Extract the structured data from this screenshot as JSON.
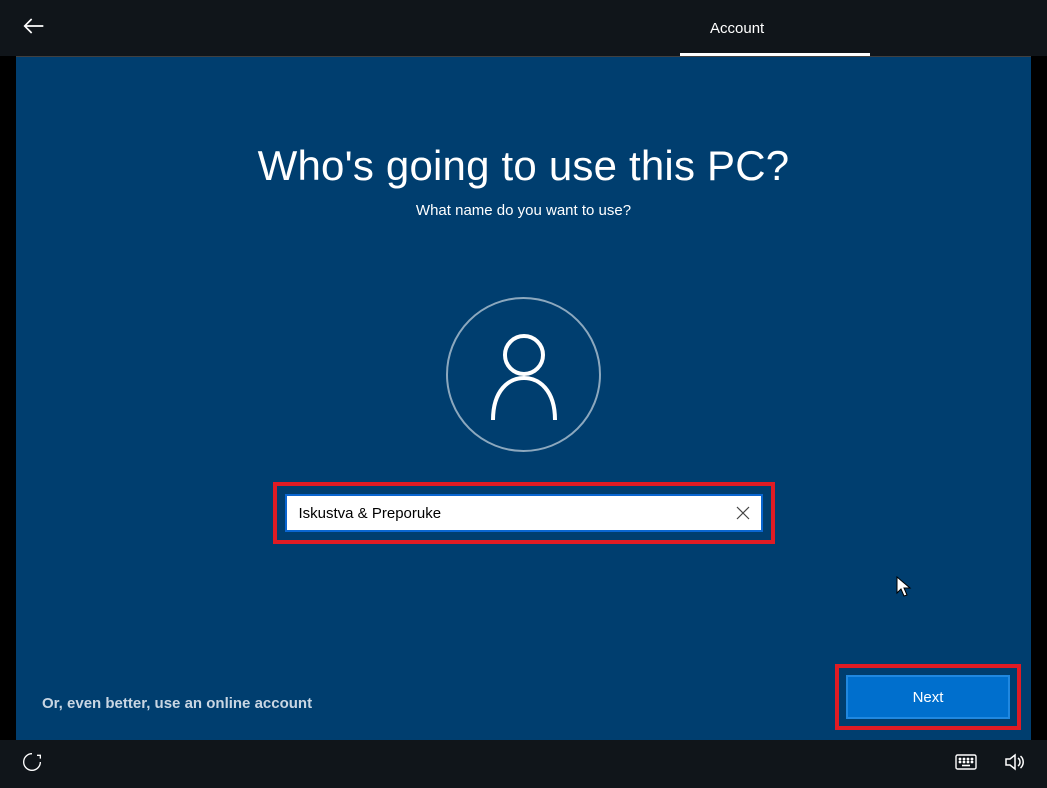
{
  "header": {
    "tab_label": "Account"
  },
  "main": {
    "title": "Who's going to use this PC?",
    "subtitle": "What name do you want to use?",
    "username_value": "Iskustva & Preporuke",
    "online_link_label": "Or, even better, use an online account",
    "next_button_label": "Next"
  }
}
